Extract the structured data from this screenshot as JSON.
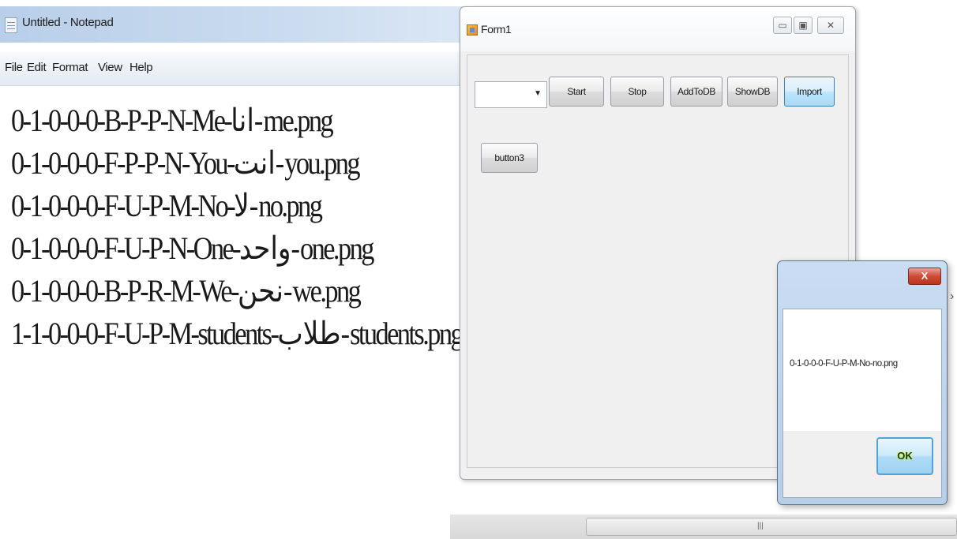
{
  "notepad": {
    "title": "Untitled - Notepad",
    "menu": [
      "File",
      "Edit",
      "Format",
      "View",
      "Help"
    ],
    "lines": [
      "0-1-0-0-0-B-P-P-N-Me-انا-me.png",
      "0-1-0-0-0-F-P-P-N-You-انت-you.png",
      "0-1-0-0-0-F-U-P-M-No-لا-no.png",
      "0-1-0-0-0-F-U-P-N-One-واحد-one.png",
      "0-1-0-0-0-B-P-R-M-We-نحن-we.png",
      "1-1-0-0-0-F-U-P-M-students-طلاب-students.png"
    ]
  },
  "form": {
    "title": "Form1",
    "caption_buttons": {
      "minimize": "▭",
      "maximize": "▣",
      "close": "✕"
    },
    "combo": {
      "value": "",
      "arrow": "▼"
    },
    "buttons": {
      "start": "Start",
      "stop": "Stop",
      "add_to_db": "AddToDB",
      "show_db": "ShowDB",
      "import": "Import",
      "button3": "button3"
    }
  },
  "messagebox": {
    "close": "X",
    "message": "0-1-0-0-0-F-U-P-M-No-no.png",
    "ok": "OK"
  },
  "scrollbar": {
    "grip": "|||"
  },
  "edge_glyph": "›"
}
